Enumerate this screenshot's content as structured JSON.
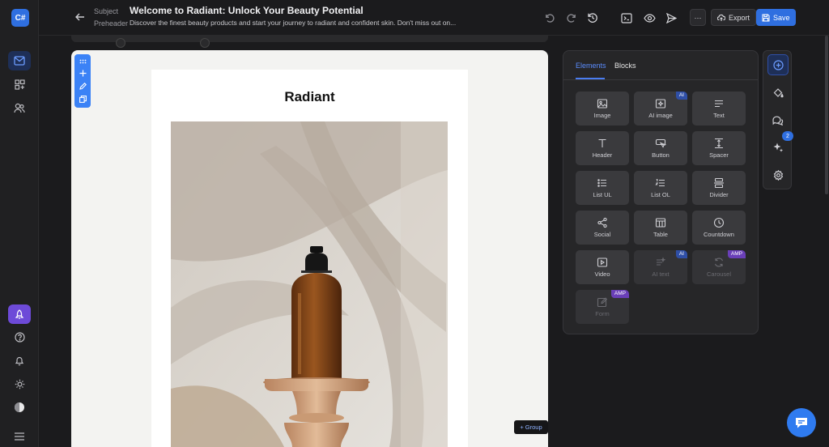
{
  "app": {
    "logo_text": "C#"
  },
  "header": {
    "subject_label": "Subject",
    "subject_value": "Welcome to Radiant: Unlock Your Beauty Potential",
    "preheader_label": "Preheader",
    "preheader_value": "Discover the finest beauty products and start your journey to radiant and confident skin. Don't miss out on...",
    "more_label": "···",
    "export_label": "Export",
    "save_label": "Save"
  },
  "email": {
    "brand": "Radiant"
  },
  "canvas": {
    "group_label": "+ Group"
  },
  "panel": {
    "tabs": [
      {
        "label": "Elements"
      },
      {
        "label": "Blocks"
      }
    ],
    "elements": [
      {
        "label": "Image",
        "icon": "image-icon"
      },
      {
        "label": "AI image",
        "icon": "ai-image-icon",
        "tag": "AI"
      },
      {
        "label": "Text",
        "icon": "text-icon"
      },
      {
        "label": "Header",
        "icon": "header-icon"
      },
      {
        "label": "Button",
        "icon": "button-icon"
      },
      {
        "label": "Spacer",
        "icon": "spacer-icon"
      },
      {
        "label": "List UL",
        "icon": "list-ul-icon"
      },
      {
        "label": "List OL",
        "icon": "list-ol-icon"
      },
      {
        "label": "Divider",
        "icon": "divider-icon"
      },
      {
        "label": "Social",
        "icon": "share-icon"
      },
      {
        "label": "Table",
        "icon": "table-icon"
      },
      {
        "label": "Countdown",
        "icon": "clock-icon"
      },
      {
        "label": "Video",
        "icon": "video-icon"
      },
      {
        "label": "AI text",
        "icon": "ai-text-icon",
        "tag": "AI",
        "disabled": true
      },
      {
        "label": "Carousel",
        "icon": "carousel-icon",
        "tag": "AMP",
        "disabled": true
      },
      {
        "label": "Form",
        "icon": "form-icon",
        "tag": "AMP",
        "disabled": true
      }
    ]
  },
  "right_toolbar": {
    "badge_count": "2"
  },
  "colors": {
    "accent": "#2f6fe0",
    "ai_tag": "#2f4fa6",
    "amp_tag": "#6a3fb8"
  }
}
